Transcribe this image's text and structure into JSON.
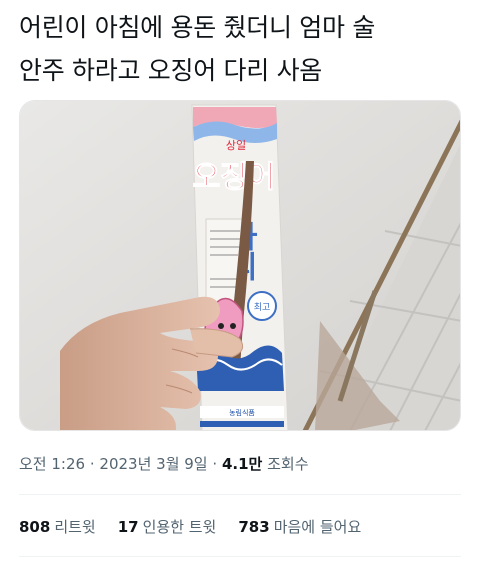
{
  "tweet": {
    "text": "어린이 아침에 용돈 줬더니 엄마 술\n안주 하라고 오징어 다리 사옴"
  },
  "media": {
    "package_brand": "상일",
    "package_title_1": "오징어",
    "package_title_2": "다리",
    "package_badge": "최고",
    "package_footer": "농림식품"
  },
  "meta": {
    "time": "오전 1:26",
    "separator": "·",
    "date": "2023년 3월 9일",
    "views_count": "4.1만",
    "views_label": "조회수"
  },
  "stats": {
    "retweets_count": "808",
    "retweets_label": "리트윗",
    "quotes_count": "17",
    "quotes_label": "인용한 트윗",
    "likes_count": "783",
    "likes_label": "마음에 들어요"
  },
  "colors": {
    "text": "#0f1419",
    "secondary": "#536471",
    "divider": "#eff3f4",
    "package_red": "#e0263a",
    "package_blue": "#1f4fa8"
  }
}
